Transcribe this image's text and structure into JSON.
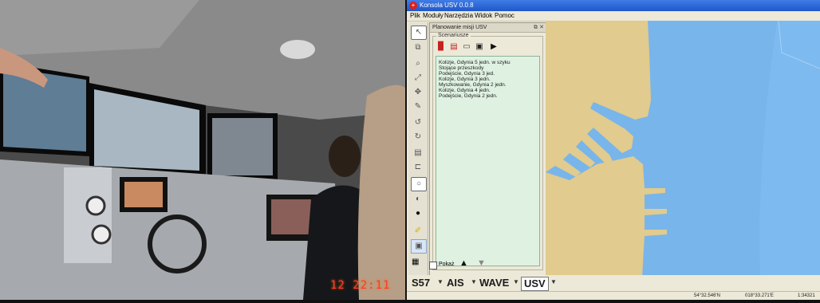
{
  "photo": {
    "timestamp": "12 22:11",
    "colors": {
      "wall": "#6e6e6e",
      "console": "#9fa3a8",
      "screen_glow": "#cfd8e0"
    }
  },
  "app": {
    "title": "Konsola USV 0.0.8",
    "menu": [
      "Plik",
      "Moduły",
      "Narzędzia",
      "Widok",
      "Pomoc"
    ],
    "panel": {
      "title": "Planowanie misji USV",
      "group_title": "Scenariusze",
      "file_tools": [
        "red-file-icon",
        "red-file-icon",
        "folder-icon",
        "save-icon",
        "play-icon"
      ],
      "scenarios": [
        "Kolizje, Gdynia 5 jedn. w szyku",
        "Stojące przeszkody",
        "Podejście, Gdynia 3 jed.",
        "Kolizje, Gdynia 3 jedn.",
        "Myszkowanie, Gdynia 2 jedn.",
        "Kolizje, Gdynia 4 jedn.",
        "Podejście, Gdynia 2 jedn."
      ],
      "show_label": "Pokaż"
    },
    "tools": [
      "select-arrow-icon",
      "crop-icon",
      "zoom-icon",
      "resize-icon",
      "pan-icon",
      "pencil-icon",
      "undo-icon",
      "redo-icon",
      "chart-icon",
      "link-icon",
      "circle-outline-icon",
      "half-circle-icon",
      "filled-circle-icon",
      "ruler-icon",
      "image-icon"
    ],
    "modes": [
      "S57",
      "AIS",
      "WAVE",
      "USV"
    ],
    "status": {
      "latitude": "54°32.546'N",
      "longitude": "018°33.271'E",
      "scale": "1:34321"
    },
    "colors": {
      "title_bar": "#2a63d6",
      "sea": "#78b5ea",
      "deep_sea": "#7dbaf0",
      "land": "#e1cb8e",
      "scenario_list": "#dff2e2"
    }
  }
}
